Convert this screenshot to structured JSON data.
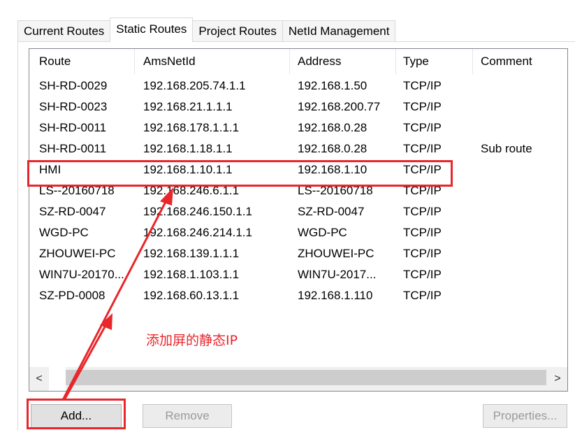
{
  "tabs": [
    {
      "label": "Current Routes",
      "active": false
    },
    {
      "label": "Static Routes",
      "active": true
    },
    {
      "label": "Project Routes",
      "active": false
    },
    {
      "label": "NetId Management",
      "active": false
    }
  ],
  "table": {
    "columns": [
      "Route",
      "AmsNetId",
      "Address",
      "Type",
      "Comment"
    ],
    "rows": [
      {
        "route": "SH-RD-0029",
        "ams": "192.168.205.74.1.1",
        "address": "192.168.1.50",
        "type": "TCP/IP",
        "comment": ""
      },
      {
        "route": "SH-RD-0023",
        "ams": "192.168.21.1.1.1",
        "address": "192.168.200.77",
        "type": "TCP/IP",
        "comment": ""
      },
      {
        "route": "SH-RD-0011",
        "ams": "192.168.178.1.1.1",
        "address": "192.168.0.28",
        "type": "TCP/IP",
        "comment": ""
      },
      {
        "route": "SH-RD-0011",
        "ams": "192.168.1.18.1.1",
        "address": "192.168.0.28",
        "type": "TCP/IP",
        "comment": "Sub route"
      },
      {
        "route": "HMI",
        "ams": "192.168.1.10.1.1",
        "address": "192.168.1.10",
        "type": "TCP/IP",
        "comment": ""
      },
      {
        "route": "LS--20160718",
        "ams": "192.168.246.6.1.1",
        "address": "LS--20160718",
        "type": "TCP/IP",
        "comment": ""
      },
      {
        "route": "SZ-RD-0047",
        "ams": "192.168.246.150.1.1",
        "address": "SZ-RD-0047",
        "type": "TCP/IP",
        "comment": ""
      },
      {
        "route": "WGD-PC",
        "ams": "192.168.246.214.1.1",
        "address": "WGD-PC",
        "type": "TCP/IP",
        "comment": ""
      },
      {
        "route": "ZHOUWEI-PC",
        "ams": "192.168.139.1.1.1",
        "address": "ZHOUWEI-PC",
        "type": "TCP/IP",
        "comment": ""
      },
      {
        "route": "WIN7U-20170...",
        "ams": "192.168.1.103.1.1",
        "address": "WIN7U-2017...",
        "type": "TCP/IP",
        "comment": ""
      },
      {
        "route": "SZ-PD-0008",
        "ams": "192.168.60.13.1.1",
        "address": "192.168.1.110",
        "type": "TCP/IP",
        "comment": ""
      }
    ]
  },
  "scrollbar": {
    "left_arrow": "<",
    "right_arrow": ">"
  },
  "buttons": {
    "add": "Add...",
    "remove": "Remove",
    "properties": "Properties..."
  },
  "annotation": {
    "note": "添加屏的静态IP",
    "color": "#e8262b"
  }
}
